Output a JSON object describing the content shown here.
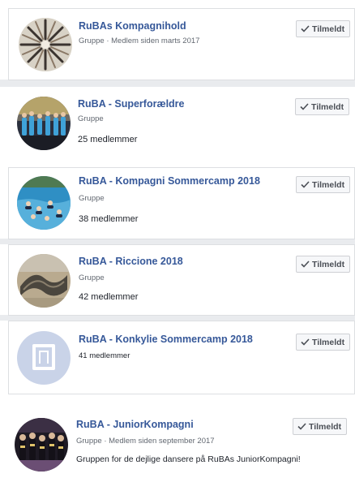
{
  "groups": [
    {
      "name": "RuBAs Kompagnihold",
      "subtitle": "Gruppe · Medlem siden marts 2017",
      "button_label": "Tilmeldt"
    },
    {
      "name": "RuBA - Superforældre",
      "subtitle": "Gruppe",
      "members": "25 medlemmer",
      "button_label": "Tilmeldt"
    },
    {
      "name": "RuBA - Kompagni Sommercamp 2018",
      "subtitle": "Gruppe",
      "members": "38 medlemmer",
      "button_label": "Tilmeldt"
    },
    {
      "name": "RuBA - Riccione 2018",
      "subtitle": "Gruppe",
      "members": "42 medlemmer",
      "button_label": "Tilmeldt"
    },
    {
      "name": "RuBA - Konkylie Sommercamp 2018",
      "members": "41 medlemmer",
      "button_label": "Tilmeldt"
    },
    {
      "name": "RuBA - JuniorKompagni",
      "subtitle": "Gruppe · Medlem siden september 2017",
      "description": "Gruppen for de dejlige dansere på RuBAs JuniorKompagni!",
      "button_label": "Tilmeldt"
    }
  ],
  "colors": {
    "link": "#365899",
    "separator": "#e9ebee",
    "button_bg": "#f6f7f9",
    "placeholder_avatar": "#c9d3e8"
  },
  "icons": {
    "joined": "checkmark-icon",
    "placeholder": "group-placeholder-icon"
  }
}
